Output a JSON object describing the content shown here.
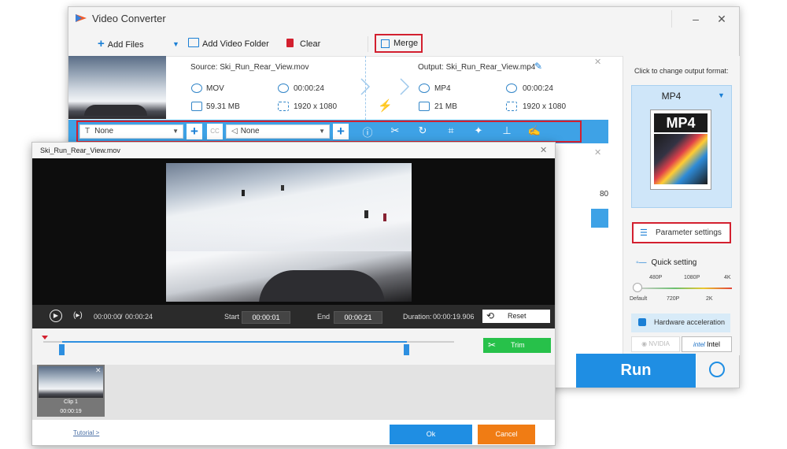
{
  "app": {
    "title": "Video Converter"
  },
  "window_controls": {
    "minimize": "–",
    "close": "✕"
  },
  "toolbar": {
    "add_files": "Add Files",
    "add_video_folder": "Add Video Folder",
    "clear": "Clear",
    "merge": "Merge"
  },
  "file_item": {
    "source_name": "Source: Ski_Run_Rear_View.mov",
    "source_format": "MOV",
    "source_duration": "00:00:24",
    "source_size": "59.31 MB",
    "source_resolution": "1920 x 1080",
    "output_name": "Output: Ski_Run_Rear_View.mp4",
    "output_format": "MP4",
    "output_duration": "00:00:24",
    "output_size": "21 MB",
    "output_resolution": "1920 x 1080"
  },
  "second_item": {
    "partial_resolution": "80"
  },
  "edit_bar": {
    "subtitle_value": "None",
    "audio_value": "None"
  },
  "right_panel": {
    "change_format_hint": "Click to change output format:",
    "format_value": "MP4",
    "format_icon_text": "MP4",
    "parameter_settings": "Parameter settings",
    "quick_setting": "Quick setting",
    "scale_top": [
      "480P",
      "1080P",
      "4K"
    ],
    "scale_bottom": [
      "Default",
      "720P",
      "2K"
    ],
    "hardware_acceleration": "Hardware acceleration",
    "nvidia": "NVIDIA",
    "intel": "Intel"
  },
  "run_button": "Run",
  "trim_dialog": {
    "title": "Ski_Run_Rear_View.mov",
    "current_time": "00:00:00",
    "separator": "/",
    "total_time": "00:00:24",
    "start_label": "Start",
    "start_value": "00:00:01",
    "end_label": "End",
    "end_value": "00:00:21",
    "duration_label": "Duration:",
    "duration_value": "00:00:19.906",
    "reset": "Reset",
    "trim": "Trim",
    "clip_name": "Clip 1",
    "clip_duration": "00:00:19",
    "tutorial": "Tutorial >",
    "ok": "Ok",
    "cancel": "Cancel"
  },
  "colors": {
    "accent_blue": "#3ea2e6",
    "run_blue": "#1f8ee3",
    "trim_green": "#27c14a",
    "cancel_orange": "#f07c14",
    "highlight_red": "#d3202f"
  }
}
